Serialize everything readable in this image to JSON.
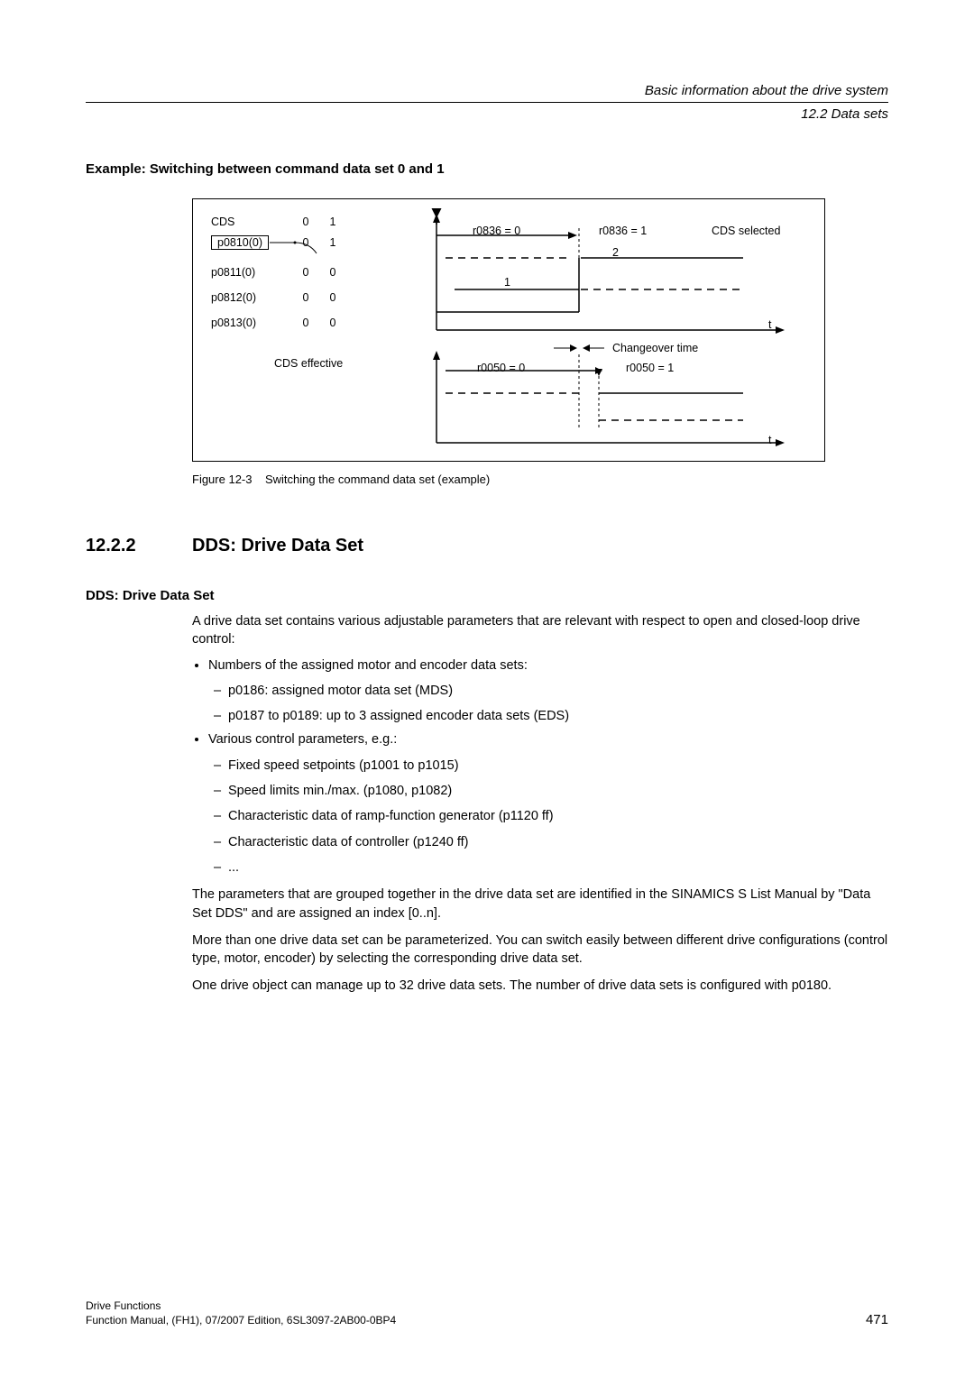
{
  "header": {
    "line1": "Basic information about the drive system",
    "line2": "12.2 Data sets"
  },
  "section_heading": "Example: Switching between command data set 0 and 1",
  "figure": {
    "cds": "CDS",
    "rows": [
      {
        "label": "p0810(0)",
        "v1": "0",
        "v2": "1"
      },
      {
        "label": "p0811(0)",
        "v1": "0",
        "v2": "0"
      },
      {
        "label": "p0812(0)",
        "v1": "0",
        "v2": "0"
      },
      {
        "label": "p0813(0)",
        "v1": "0",
        "v2": "0"
      }
    ],
    "p0810_second_v1": "0",
    "p0810_second_v2": "1",
    "cds_effective": "CDS effective",
    "r0836_0": "r0836 = 0",
    "r0836_1": "r0836 = 1",
    "cds_selected": "CDS selected",
    "one": "1",
    "two": "2",
    "changeover": "Changeover time",
    "r0050_0": "r0050 = 0",
    "r0050_1": "r0050 = 1",
    "t1": "t",
    "t2": "t"
  },
  "figure_caption_label": "Figure 12-3",
  "figure_caption_text": "Switching the command data set (example)",
  "h2_num": "12.2.2",
  "h2_title": "DDS: Drive Data Set",
  "h3_title": "DDS: Drive Data Set",
  "para1": "A drive data set contains various adjustable parameters that are relevant with respect to open and closed-loop drive control:",
  "b1_1": "Numbers of the assigned motor and encoder data sets:",
  "b1_1_sub": [
    "p0186: assigned motor data set (MDS)",
    "p0187 to p0189: up to 3 assigned encoder data sets (EDS)"
  ],
  "b1_2": "Various control parameters, e.g.:",
  "b1_2_sub": [
    "Fixed speed setpoints (p1001 to p1015)",
    "Speed limits min./max. (p1080, p1082)",
    "Characteristic data of ramp-function generator (p1120 ff)",
    "Characteristic data of controller (p1240 ff)",
    "..."
  ],
  "para2": "The parameters that are grouped together in the drive data set are identified in the SINAMICS S List Manual by \"Data Set DDS\" and are assigned an index [0..n].",
  "para3": "More than one drive data set can be parameterized. You can switch easily between different drive configurations (control type, motor, encoder) by selecting the corresponding drive data set.",
  "para4": "One drive object can manage up to 32 drive data sets. The number of drive data sets is configured with p0180.",
  "footer": {
    "l1": "Drive Functions",
    "l2": "Function Manual, (FH1), 07/2007 Edition, 6SL3097-2AB00-0BP4",
    "page": "471"
  }
}
